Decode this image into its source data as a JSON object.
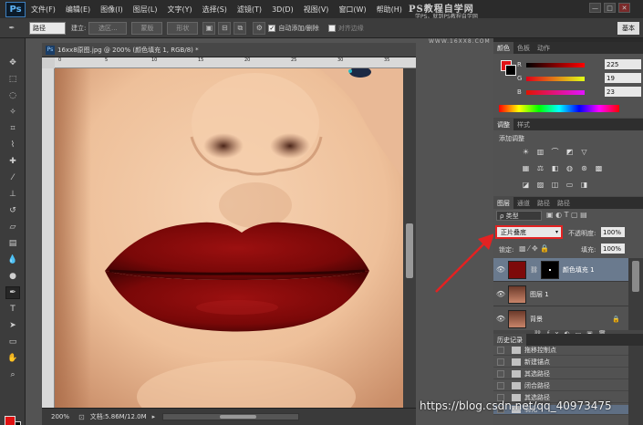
{
  "app": {
    "logo": "Ps",
    "menu": [
      "文件(F)",
      "编辑(E)",
      "图像(I)",
      "图层(L)",
      "文字(Y)",
      "选择(S)",
      "滤镜(T)",
      "3D(D)",
      "视图(V)",
      "窗口(W)",
      "帮助(H)"
    ],
    "watermark_title": "PS教程自学网",
    "watermark_sub": "学PS，就到PS教程自学网",
    "watermark_url": "WWW.16XX8.COM",
    "window_buttons": [
      "—",
      "□",
      "✕"
    ]
  },
  "options": {
    "mode_select": "路径",
    "create_label": "建立:",
    "selection_btn": "选区...",
    "mask_btn": "蒙版",
    "shape_btn": "形状",
    "auto_add_label": "自动添加/删除",
    "auto_add_checked": true,
    "align_edges_label": "对齐边缘",
    "workspace": "基本"
  },
  "document": {
    "tab_title": "16xx8原图.jpg @ 200% (颜色填充 1, RGB/8) *",
    "tab_icon": "Ps",
    "ruler_numbers": [
      "0",
      "5",
      "10",
      "15",
      "20",
      "25",
      "30",
      "35"
    ],
    "zoom": "200%",
    "doc_info": "文档:5.86M/12.0M"
  },
  "color_panel": {
    "tabs": [
      "颜色",
      "色板",
      "动作"
    ],
    "r_label": "R",
    "r_value": "225",
    "g_label": "G",
    "g_value": "19",
    "b_label": "B",
    "b_value": "23",
    "foreground": "#e11317"
  },
  "adjust_panel": {
    "tabs": [
      "调整",
      "样式"
    ],
    "title": "添加调整"
  },
  "layers_panel": {
    "tabs": [
      "图层",
      "通道",
      "路径",
      "路径"
    ],
    "kind_label": "ρ 类型",
    "blend_mode": "正片叠底",
    "opacity_label": "不透明度:",
    "opacity_value": "100%",
    "lock_label": "锁定:",
    "fill_label": "填充:",
    "fill_value": "100%",
    "layers": [
      {
        "name": "颜色填充 1",
        "selected": true
      },
      {
        "name": "图层 1",
        "selected": false
      },
      {
        "name": "背景",
        "selected": false
      }
    ]
  },
  "history_panel": {
    "tab": "历史记录",
    "items": [
      "拖移控制点",
      "新建锚点",
      "其选路径",
      "闭合路径",
      "其选路径",
      "羽化"
    ]
  },
  "credit": "https://blog.csdn.net/qq_40973475"
}
